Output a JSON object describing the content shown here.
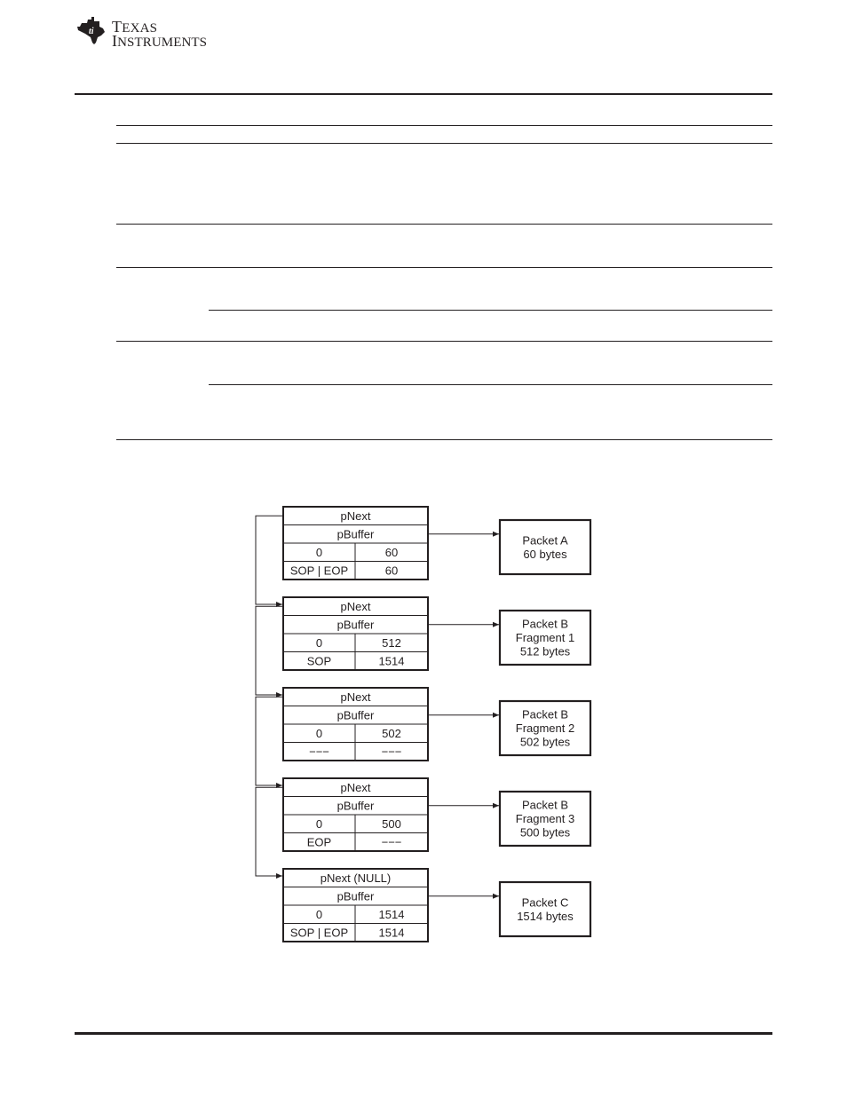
{
  "header": {
    "logo": {
      "icon": "ti-texas-logo-icon",
      "line1_cap": "T",
      "line1_rest": "EXAS",
      "line2_cap": "I",
      "line2_rest": "NSTRUMENTS"
    }
  },
  "diagram": {
    "descriptors": [
      {
        "pnext": "pNext",
        "pbuffer": "pBuffer",
        "offset": "0",
        "buf_len": "60",
        "flags": "SOP | EOP",
        "pkt_len": "60",
        "target": {
          "lines": [
            "Packet A",
            "60 bytes"
          ]
        }
      },
      {
        "pnext": "pNext",
        "pbuffer": "pBuffer",
        "offset": "0",
        "buf_len": "512",
        "flags": "SOP",
        "pkt_len": "1514",
        "target": {
          "lines": [
            "Packet B",
            "Fragment 1",
            "512 bytes"
          ]
        }
      },
      {
        "pnext": "pNext",
        "pbuffer": "pBuffer",
        "offset": "0",
        "buf_len": "502",
        "flags": "−−−",
        "pkt_len": "−−−",
        "target": {
          "lines": [
            "Packet B",
            "Fragment 2",
            "502 bytes"
          ]
        }
      },
      {
        "pnext": "pNext",
        "pbuffer": "pBuffer",
        "offset": "0",
        "buf_len": "500",
        "flags": "EOP",
        "pkt_len": "−−−",
        "target": {
          "lines": [
            "Packet B",
            "Fragment 3",
            "500 bytes"
          ]
        }
      },
      {
        "pnext": "pNext (NULL)",
        "pbuffer": "pBuffer",
        "offset": "0",
        "buf_len": "1514",
        "flags": "SOP | EOP",
        "pkt_len": "1514",
        "target": {
          "lines": [
            "Packet C",
            "1514 bytes"
          ]
        }
      }
    ]
  }
}
